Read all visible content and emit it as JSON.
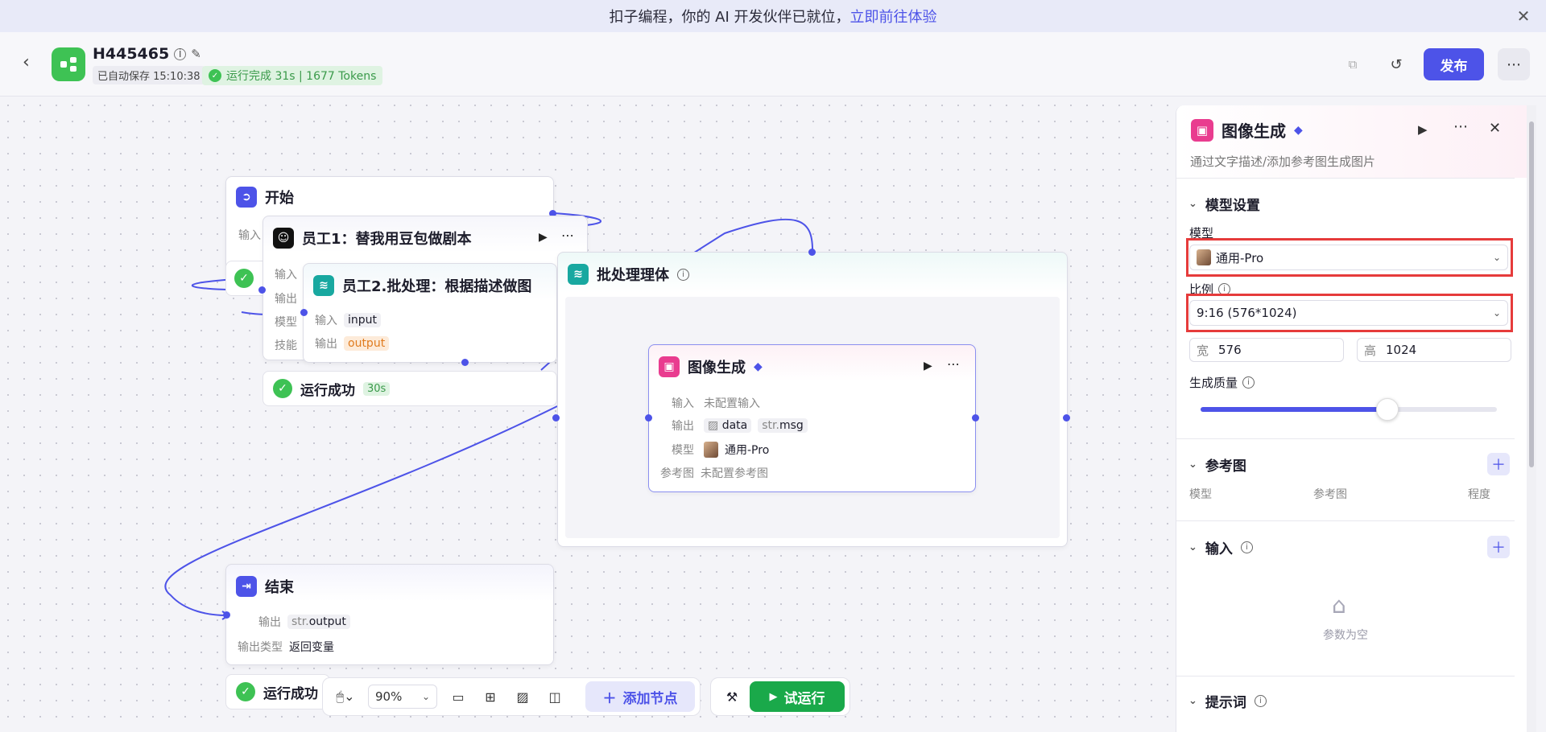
{
  "banner": {
    "text": "扣子编程，你的 AI 开发伙伴已就位，",
    "link": "立即前往体验",
    "close": "✕"
  },
  "header": {
    "title": "H445465",
    "saved": "已自动保存 15:10:38",
    "run_status": "运行完成 31s | 1677 Tokens",
    "publish": "发布",
    "more": "⋯"
  },
  "nodes": {
    "start": {
      "title": "开始",
      "input_label": "输入"
    },
    "emp1": {
      "title": "员工1：替我用豆包做剧本",
      "rows": [
        "输入",
        "输出",
        "模型",
        "技能"
      ]
    },
    "emp2": {
      "title": "员工2.批处理：根据描述做图",
      "input_label": "输入",
      "input_val": "input",
      "output_label": "输出",
      "output_val": "output"
    },
    "batch": {
      "title": "批处理理体"
    },
    "img": {
      "title": "图像生成",
      "input_label": "输入",
      "input_val": "未配置输入",
      "output_label": "输出",
      "out1": "data",
      "out2_prefix": "str.",
      "out2": "msg",
      "model_label": "模型",
      "model_val": "通用-Pro",
      "ref_label": "参考图",
      "ref_val": "未配置参考图"
    },
    "end": {
      "title": "结束",
      "output_label": "输出",
      "output_prefix": "str.",
      "output_val": "output",
      "type_label": "输出类型",
      "type_val": "返回变量"
    }
  },
  "badges": {
    "run_success": "运行成功",
    "time": "30s"
  },
  "toolbar": {
    "zoom": "90%",
    "add_node": "添加节点",
    "run": "试运行"
  },
  "panel": {
    "title": "图像生成",
    "desc": "通过文字描述/添加参考图生成图片",
    "model_section": "模型设置",
    "model_label": "模型",
    "model_value": "通用-Pro",
    "ratio_label": "比例",
    "ratio_value": "9:16 (576*1024)",
    "width_label": "宽",
    "width_value": "576",
    "height_label": "高",
    "height_value": "1024",
    "quality_label": "生成质量",
    "quality_level": 0.63,
    "ref_section": "参考图",
    "ref_cols": [
      "模型",
      "参考图",
      "程度"
    ],
    "input_section": "输入",
    "empty_text": "参数为空",
    "prompt_section": "提示词"
  },
  "colors": {
    "accent": "#4d53e8",
    "success": "#3ec254",
    "run": "#1aa94a",
    "highlight": "#e63b3b"
  }
}
